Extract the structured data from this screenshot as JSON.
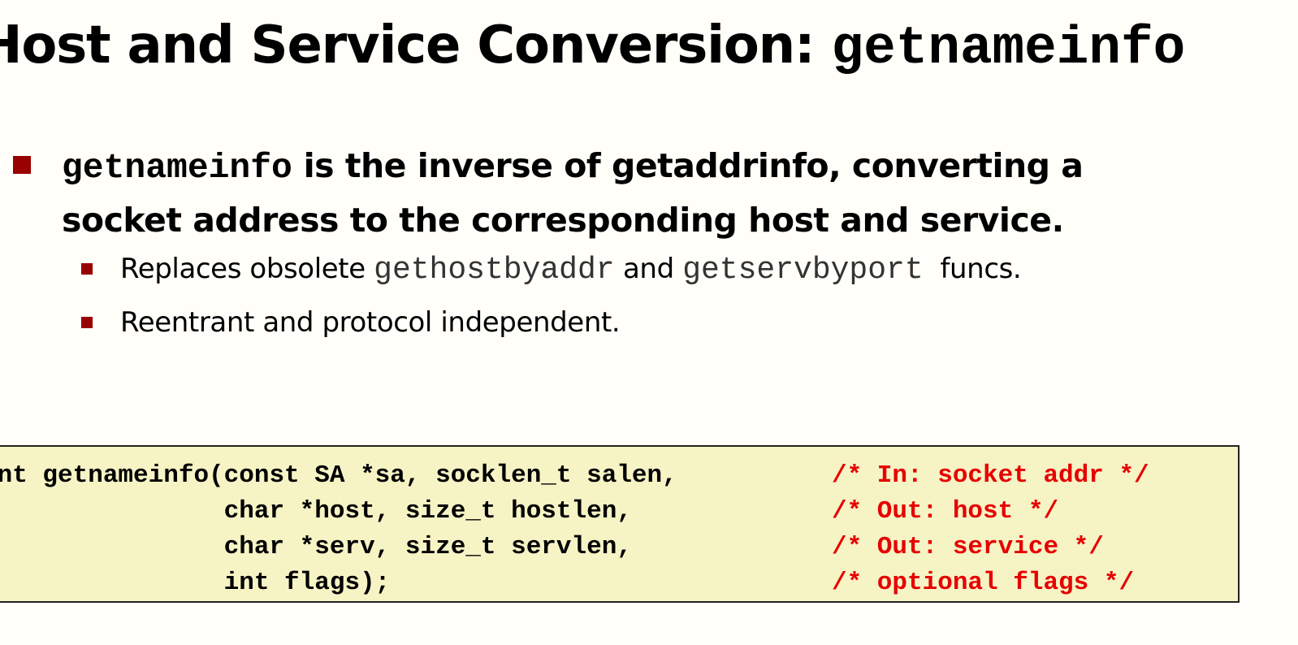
{
  "title": {
    "text": "Host and Service Conversion: ",
    "code": "getnameinfo"
  },
  "bullet": {
    "code": "getnameinfo",
    "text_line1": " is the inverse of getaddrinfo, converting a",
    "text_line2": "socket address to the corresponding host and service."
  },
  "subbullets": [
    {
      "pre": "Replaces obsolete ",
      "code1": "gethostbyaddr",
      "mid": " and ",
      "code2": "getservbyport",
      "post": "  funcs."
    },
    {
      "text": "Reentrant and protocol independent."
    }
  ],
  "code_box": {
    "lines": [
      {
        "code": "int getnameinfo(const SA *sa, socklen_t salen,",
        "comment": "/* In: socket addr */"
      },
      {
        "code": "                char *host, size_t hostlen,",
        "comment": "/* Out: host */"
      },
      {
        "code": "                char *serv, size_t servlen,",
        "comment": "/* Out: service */"
      },
      {
        "code": "                int flags);",
        "comment": "/* optional flags */"
      }
    ]
  },
  "colors": {
    "bullet": "#990000",
    "comment": "#e60000",
    "code_box_bg": "#f6f3c5"
  }
}
